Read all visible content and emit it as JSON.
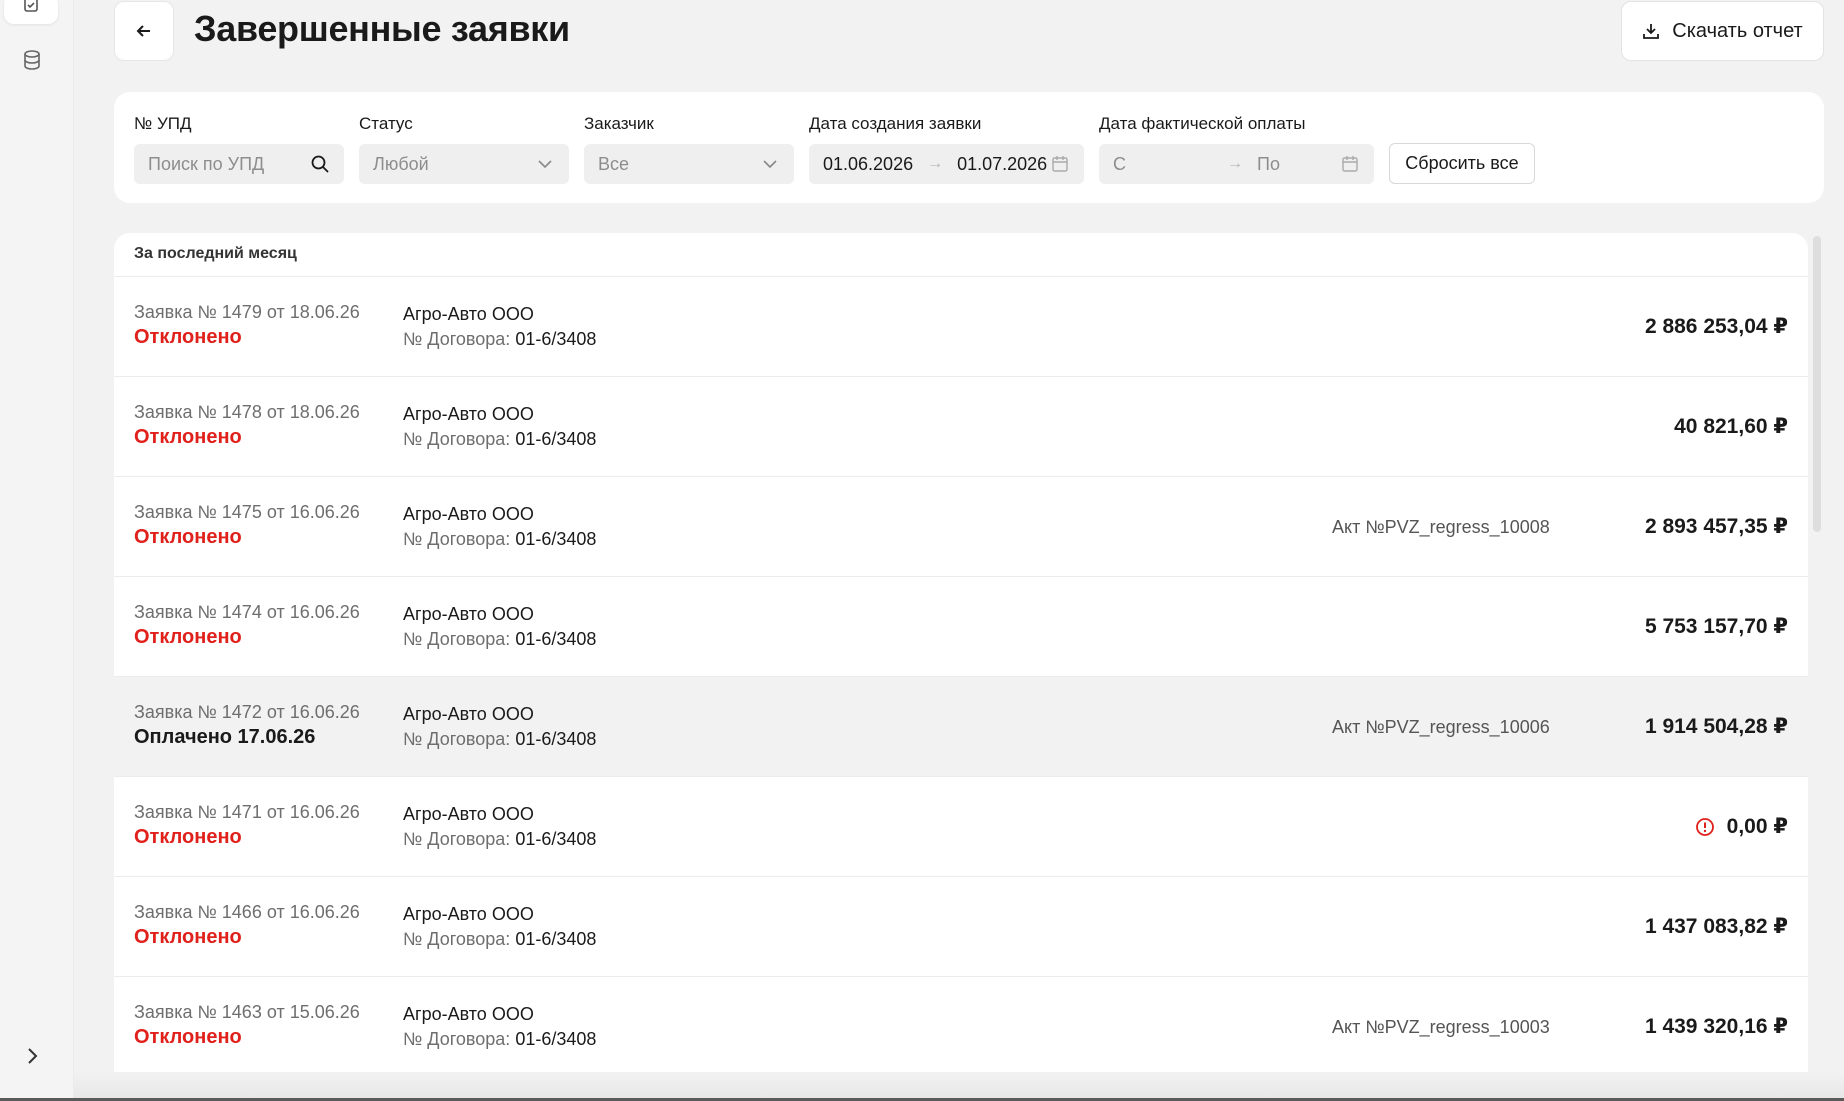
{
  "header": {
    "title": "Завершенные заявки",
    "download_label": "Скачать отчет"
  },
  "filters": {
    "upd": {
      "label": "№ УПД",
      "placeholder": "Поиск по УПД"
    },
    "status": {
      "label": "Статус",
      "value": "Любой"
    },
    "customer": {
      "label": "Заказчик",
      "value": "Все"
    },
    "created": {
      "label": "Дата создания заявки",
      "from": "01.06.2026",
      "to": "01.07.2026"
    },
    "paid": {
      "label": "Дата фактической оплаты",
      "from_placeholder": "С",
      "to_placeholder": "По"
    },
    "reset_label": "Сбросить все"
  },
  "list": {
    "group_title": "За последний месяц",
    "contract_key": "№ Договора:",
    "rows": [
      {
        "request": "Заявка № 1479 от 18.06.26",
        "status": "Отклонено",
        "client": "Агро-Авто ООО",
        "contract": "01-6/3408",
        "act": "",
        "amount": "2 886 253,04 ₽"
      },
      {
        "request": "Заявка № 1478 от 18.06.26",
        "status": "Отклонено",
        "client": "Агро-Авто ООО",
        "contract": "01-6/3408",
        "act": "",
        "amount": "40 821,60 ₽"
      },
      {
        "request": "Заявка № 1475 от 16.06.26",
        "status": "Отклонено",
        "client": "Агро-Авто ООО",
        "contract": "01-6/3408",
        "act": "Акт №PVZ_regress_10008",
        "amount": "2 893 457,35 ₽"
      },
      {
        "request": "Заявка № 1474 от 16.06.26",
        "status": "Отклонено",
        "client": "Агро-Авто ООО",
        "contract": "01-6/3408",
        "act": "",
        "amount": "5 753 157,70 ₽"
      },
      {
        "request": "Заявка № 1472 от 16.06.26",
        "status": "Оплачено 17.06.26",
        "client": "Агро-Авто ООО",
        "contract": "01-6/3408",
        "act": "Акт №PVZ_regress_10006",
        "amount": "1 914 504,28 ₽"
      },
      {
        "request": "Заявка № 1471 от 16.06.26",
        "status": "Отклонено",
        "client": "Агро-Авто ООО",
        "contract": "01-6/3408",
        "act": "",
        "amount": "0,00 ₽"
      },
      {
        "request": "Заявка № 1466 от 16.06.26",
        "status": "Отклонено",
        "client": "Агро-Авто ООО",
        "contract": "01-6/3408",
        "act": "",
        "amount": "1 437 083,82 ₽"
      },
      {
        "request": "Заявка № 1463 от 15.06.26",
        "status": "Отклонено",
        "client": "Агро-Авто ООО",
        "contract": "01-6/3408",
        "act": "Акт №PVZ_regress_10003",
        "amount": "1 439 320,16 ₽"
      }
    ]
  },
  "colors": {
    "rejected": "#e0201b",
    "highlight_row": "#f1f2f1",
    "warning": "#e0201b"
  },
  "icons": [
    "clipboard-icon",
    "database-icon",
    "chevron-right-icon",
    "arrow-left-icon",
    "download-icon",
    "search-icon",
    "chevron-down-icon",
    "calendar-icon",
    "warning-icon"
  ]
}
